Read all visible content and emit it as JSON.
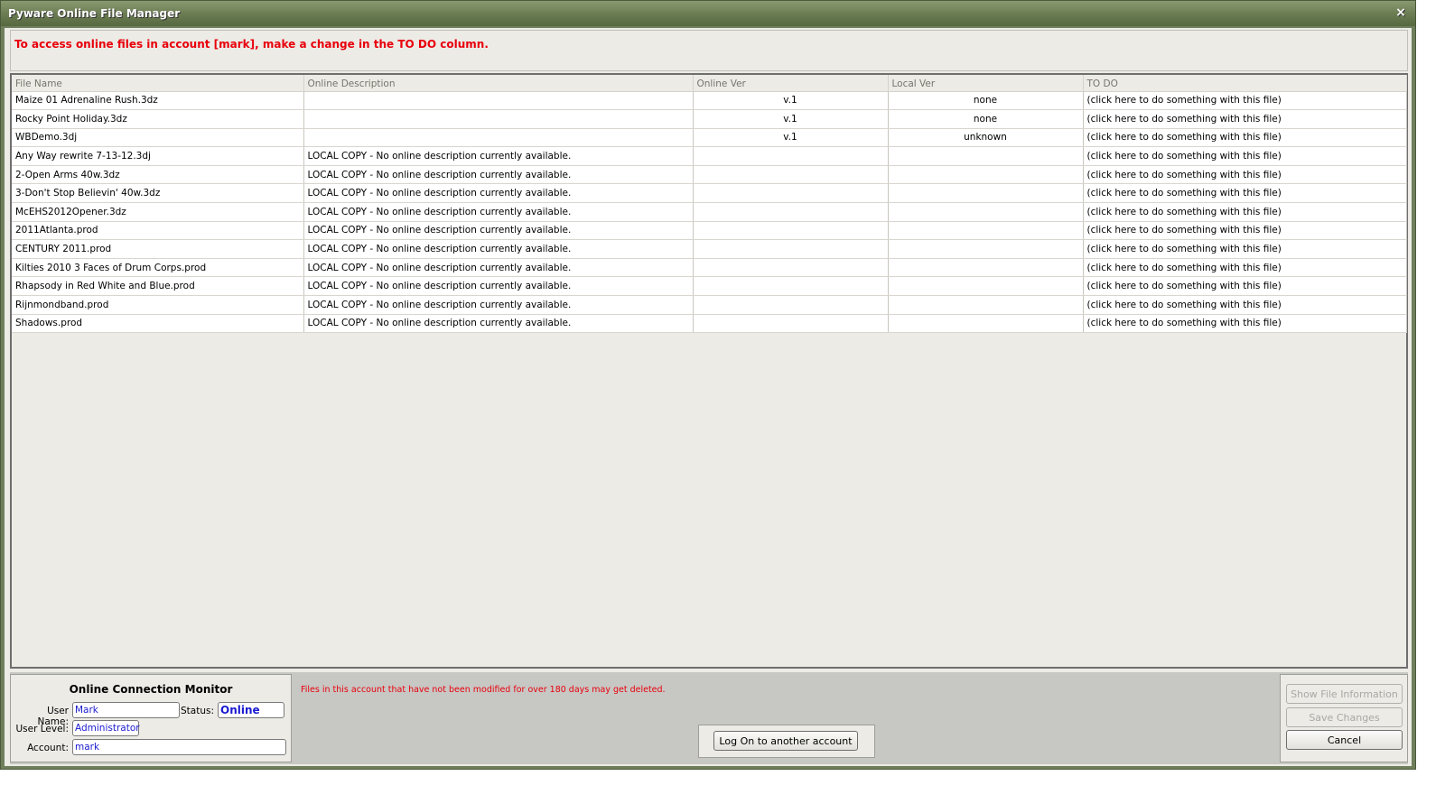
{
  "window": {
    "title": "Pyware Online File Manager",
    "close_glyph": "×"
  },
  "message": "To access online files in account [mark], make a change in the TO DO column.",
  "table": {
    "columns": [
      "File Name",
      "Online Description",
      "Online Ver",
      "Local Ver",
      "TO DO"
    ],
    "rows": [
      {
        "file": "Maize 01 Adrenaline Rush.3dz",
        "desc": "",
        "online_ver": "v.1",
        "local_ver": "none",
        "todo": "(click here to do something with this file)"
      },
      {
        "file": "Rocky Point Holiday.3dz",
        "desc": "",
        "online_ver": "v.1",
        "local_ver": "none",
        "todo": "(click here to do something with this file)"
      },
      {
        "file": "WBDemo.3dj",
        "desc": "",
        "online_ver": "v.1",
        "local_ver": "unknown",
        "todo": "(click here to do something with this file)"
      },
      {
        "file": "Any Way rewrite 7-13-12.3dj",
        "desc": "LOCAL COPY - No online description currently available.",
        "online_ver": "",
        "local_ver": "",
        "todo": "(click here to do something with this file)"
      },
      {
        "file": "2-Open Arms 40w.3dz",
        "desc": "LOCAL COPY - No online description currently available.",
        "online_ver": "",
        "local_ver": "",
        "todo": "(click here to do something with this file)"
      },
      {
        "file": "3-Don't Stop Believin' 40w.3dz",
        "desc": "LOCAL COPY - No online description currently available.",
        "online_ver": "",
        "local_ver": "",
        "todo": "(click here to do something with this file)"
      },
      {
        "file": "McEHS2012Opener.3dz",
        "desc": "LOCAL COPY - No online description currently available.",
        "online_ver": "",
        "local_ver": "",
        "todo": "(click here to do something with this file)"
      },
      {
        "file": "2011Atlanta.prod",
        "desc": "LOCAL COPY - No online description currently available.",
        "online_ver": "",
        "local_ver": "",
        "todo": "(click here to do something with this file)"
      },
      {
        "file": "CENTURY 2011.prod",
        "desc": "LOCAL COPY - No online description currently available.",
        "online_ver": "",
        "local_ver": "",
        "todo": "(click here to do something with this file)"
      },
      {
        "file": "Kilties 2010 3 Faces of Drum Corps.prod",
        "desc": "LOCAL COPY - No online description currently available.",
        "online_ver": "",
        "local_ver": "",
        "todo": "(click here to do something with this file)"
      },
      {
        "file": "Rhapsody in Red White and Blue.prod",
        "desc": "LOCAL COPY - No online description currently available.",
        "online_ver": "",
        "local_ver": "",
        "todo": "(click here to do something with this file)"
      },
      {
        "file": "Rijnmondband.prod",
        "desc": "LOCAL COPY - No online description currently available.",
        "online_ver": "",
        "local_ver": "",
        "todo": "(click here to do something with this file)"
      },
      {
        "file": "Shadows.prod",
        "desc": "LOCAL COPY - No online description currently available.",
        "online_ver": "",
        "local_ver": "",
        "todo": "(click here to do something with this file)"
      }
    ]
  },
  "monitor": {
    "title": "Online Connection Monitor",
    "user_name_label": "User Name:",
    "user_name": "Mark",
    "status_label": "Status:",
    "status": "Online",
    "user_level_label": "User Level:",
    "user_level": "Administrator",
    "account_label": "Account:",
    "account": "mark"
  },
  "warning": "Files in this account that have not been modified for over 180 days may get deleted.",
  "buttons": {
    "logon": "Log On to another account",
    "show_info": "Show File Information",
    "save": "Save Changes",
    "cancel": "Cancel"
  },
  "colors": {
    "title_bar": "#6c7d54",
    "alert_red": "#e8000b",
    "field_text": "#1a1ad0"
  }
}
